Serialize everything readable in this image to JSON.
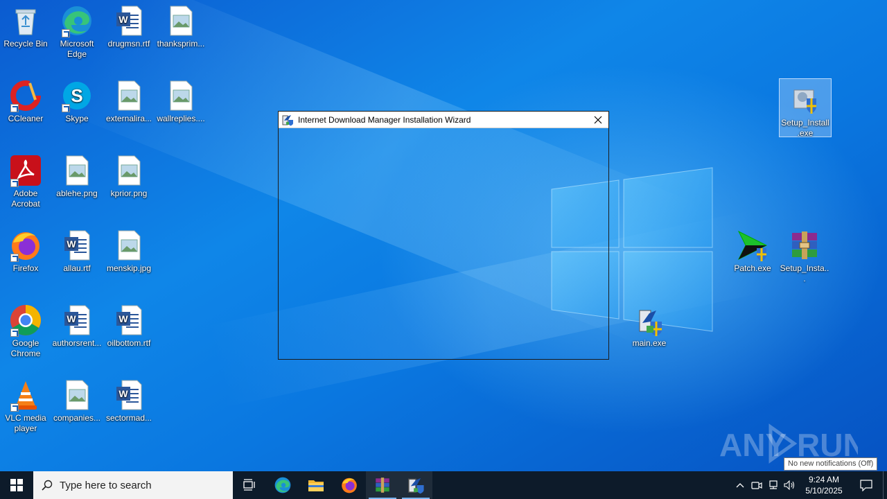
{
  "desktop": {
    "icons": [
      {
        "label": "Recycle Bin",
        "icon": "recycle-bin-icon"
      },
      {
        "label": "Microsoft Edge",
        "icon": "edge-icon"
      },
      {
        "label": "drugmsn.rtf",
        "icon": "word-document-icon"
      },
      {
        "label": "thanksprim...",
        "icon": "image-file-icon"
      },
      {
        "label": "CCleaner",
        "icon": "ccleaner-icon"
      },
      {
        "label": "Skype",
        "icon": "skype-icon"
      },
      {
        "label": "externalira...",
        "icon": "image-file-icon"
      },
      {
        "label": "wallreplies....",
        "icon": "image-file-icon"
      },
      {
        "label": "Adobe Acrobat",
        "icon": "acrobat-icon"
      },
      {
        "label": "ablehe.png",
        "icon": "image-file-icon"
      },
      {
        "label": "kprior.png",
        "icon": "image-file-icon"
      },
      {
        "label": "Firefox",
        "icon": "firefox-icon"
      },
      {
        "label": "allau.rtf",
        "icon": "word-document-icon"
      },
      {
        "label": "menskip.jpg",
        "icon": "image-file-icon"
      },
      {
        "label": "Google Chrome",
        "icon": "chrome-icon"
      },
      {
        "label": "authorsrent...",
        "icon": "word-document-icon"
      },
      {
        "label": "oilbottom.rtf",
        "icon": "word-document-icon"
      },
      {
        "label": "VLC media player",
        "icon": "vlc-icon"
      },
      {
        "label": "companies...",
        "icon": "image-file-icon"
      },
      {
        "label": "sectormad...",
        "icon": "word-document-icon"
      },
      {
        "label": "Setup_Install.exe",
        "icon": "installer-shield-icon"
      },
      {
        "label": "Patch.exe",
        "icon": "idm-patch-icon"
      },
      {
        "label": "Setup_Insta...",
        "icon": "winrar-archive-icon"
      },
      {
        "label": "main.exe",
        "icon": "setup-exe-icon"
      }
    ]
  },
  "wizard": {
    "title": "Internet Download Manager Installation Wizard",
    "close_icon": "close-icon"
  },
  "watermark": {
    "text": "ANY RUN"
  },
  "notification_tooltip": "No new notifications (Off)",
  "taskbar": {
    "search_placeholder": "Type here to search",
    "pinned": [
      "task-view-icon",
      "edge-icon",
      "file-explorer-icon",
      "firefox-icon",
      "winrar-icon",
      "idm-setup-icon"
    ],
    "clock_time": "9:24 AM",
    "clock_date": "5/10/2025"
  },
  "colors": {
    "desktop_bg": "#0b6fd6",
    "taskbar_bg": "#0d1b2a",
    "titlebar_bg": "#ffffff"
  }
}
